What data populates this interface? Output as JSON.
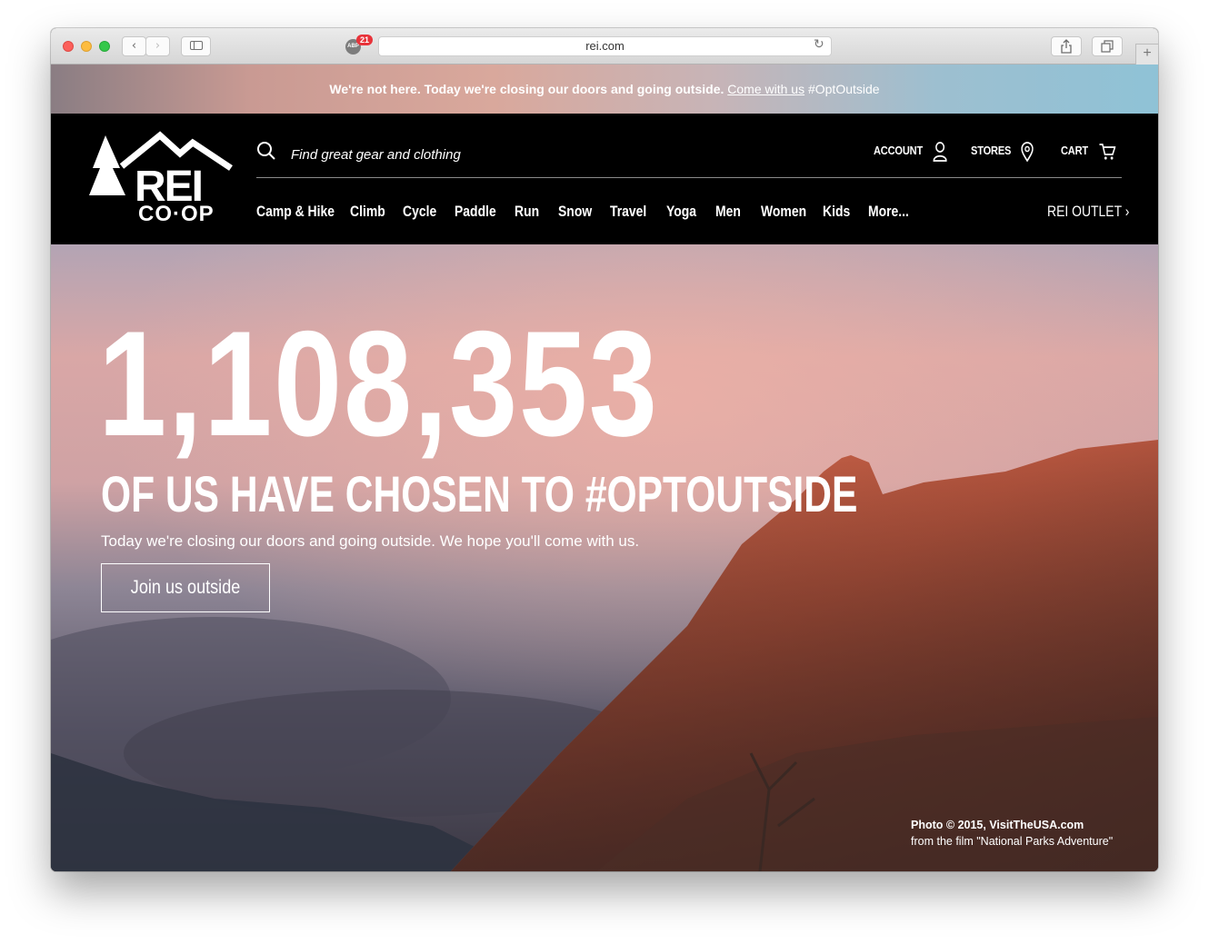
{
  "browser": {
    "url": "rei.com",
    "adblock_badge": "21",
    "adblock_label": "ABP"
  },
  "announcement": {
    "message": "We're not here. Today we're closing our doors and going outside.",
    "link_text": "Come with us",
    "hashtag": "#OptOutside"
  },
  "header": {
    "logo_text_top": "REI",
    "logo_text_bottom": "CO·OP",
    "search_placeholder": "Find great gear and clothing",
    "account_label": "ACCOUNT",
    "stores_label": "STORES",
    "cart_label": "CART",
    "nav": [
      "Camp & Hike",
      "Climb",
      "Cycle",
      "Paddle",
      "Run",
      "Snow",
      "Travel",
      "Yoga",
      "Men",
      "Women",
      "Kids",
      "More..."
    ],
    "outlet_label": "REI OUTLET"
  },
  "hero": {
    "count": "1,108,353",
    "headline": "OF US HAVE CHOSEN TO #OPTOUTSIDE",
    "subtext": "Today we're closing our doors and going outside. We hope you'll come with us.",
    "cta_label": "Join us outside",
    "credit_line1": "Photo © 2015, VisitTheUSA.com",
    "credit_line2": "from the film \"National Parks Adventure\""
  },
  "colors": {
    "header_bg": "#000000",
    "text": "#ffffff",
    "mountain": "#b8553e"
  }
}
